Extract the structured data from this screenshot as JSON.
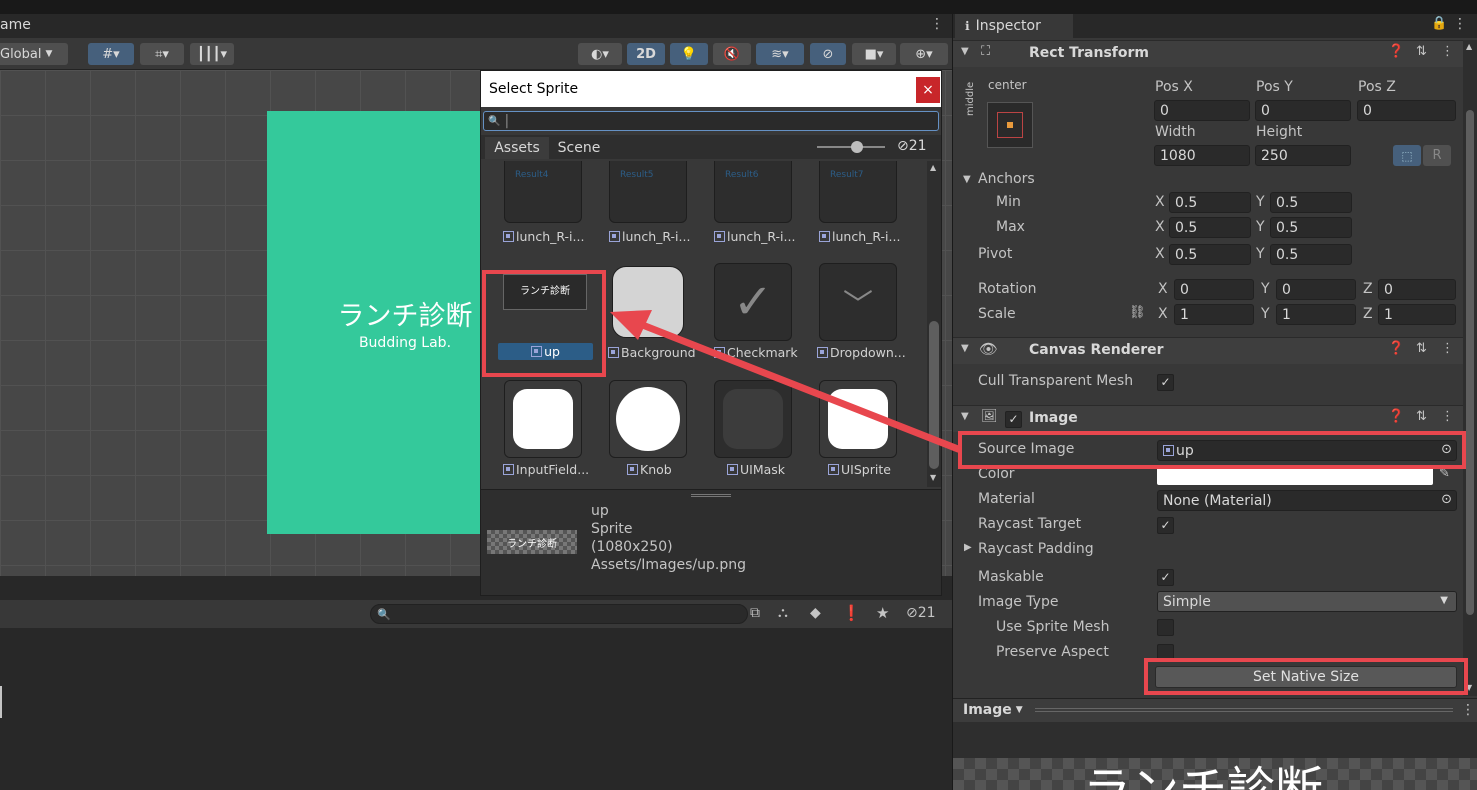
{
  "scene": {
    "tab_label": "ame",
    "toolbar": {
      "global_label": "Global",
      "mode_2d": "2D"
    },
    "canvas_title": "ランチ診断",
    "canvas_subtitle": "Budding Lab."
  },
  "project": {
    "count_label": "21"
  },
  "dialog": {
    "title": "Select Sprite",
    "close_symbol": "×",
    "search_placeholder": "",
    "tabs": [
      "Assets",
      "Scene"
    ],
    "hidden_count": "21",
    "row1": [
      {
        "label": "lunch_R-i...",
        "caption": "Result4"
      },
      {
        "label": "lunch_R-i...",
        "caption": "Result5"
      },
      {
        "label": "lunch_R-i...",
        "caption": "Result6"
      },
      {
        "label": "lunch_R-i...",
        "caption": "Result7"
      }
    ],
    "row2": [
      {
        "label": "up"
      },
      {
        "label": "Background"
      },
      {
        "label": "Checkmark"
      },
      {
        "label": "Dropdown..."
      }
    ],
    "row3": [
      {
        "label": "InputField..."
      },
      {
        "label": "Knob"
      },
      {
        "label": "UIMask"
      },
      {
        "label": "UISprite"
      }
    ],
    "up_thumb_text": "ランチ診断",
    "preview": {
      "name": "up",
      "type": "Sprite",
      "size": "(1080x250)",
      "path": "Assets/Images/up.png",
      "thumb_text": "ランチ診断"
    }
  },
  "inspector": {
    "tab_label": "Inspector",
    "rect_transform": {
      "header": "Rect Transform",
      "anchor_h": "center",
      "anchor_v": "middle",
      "pos_x_label": "Pos X",
      "pos_x": "0",
      "pos_y_label": "Pos Y",
      "pos_y": "0",
      "pos_z_label": "Pos Z",
      "pos_z": "0",
      "width_label": "Width",
      "width": "1080",
      "height_label": "Height",
      "height": "250",
      "r_button": "R",
      "anchors_label": "Anchors",
      "min_label": "Min",
      "min_x": "0.5",
      "min_y": "0.5",
      "max_label": "Max",
      "max_x": "0.5",
      "max_y": "0.5",
      "pivot_label": "Pivot",
      "pivot_x": "0.5",
      "pivot_y": "0.5",
      "rotation_label": "Rotation",
      "rot_x": "0",
      "rot_y": "0",
      "rot_z": "0",
      "scale_label": "Scale",
      "scale_x": "1",
      "scale_y": "1",
      "scale_z": "1",
      "x": "X",
      "y": "Y",
      "z": "Z"
    },
    "canvas_renderer": {
      "header": "Canvas Renderer",
      "cull_label": "Cull Transparent Mesh"
    },
    "image": {
      "header": "Image",
      "source_image_label": "Source Image",
      "source_image_value": "up",
      "color_label": "Color",
      "material_label": "Material",
      "material_value": "None (Material)",
      "raycast_target_label": "Raycast Target",
      "raycast_padding_label": "Raycast Padding",
      "maskable_label": "Maskable",
      "image_type_label": "Image Type",
      "image_type_value": "Simple",
      "use_sprite_mesh_label": "Use Sprite Mesh",
      "preserve_aspect_label": "Preserve Aspect",
      "set_native_size_label": "Set Native Size"
    },
    "preview_bar_label": "Image",
    "preview_text": "ランチ診断"
  },
  "colors": {
    "highlight_red": "#e8474e",
    "canvas_green": "#34c99b",
    "selection_blue": "#2c5d87"
  }
}
